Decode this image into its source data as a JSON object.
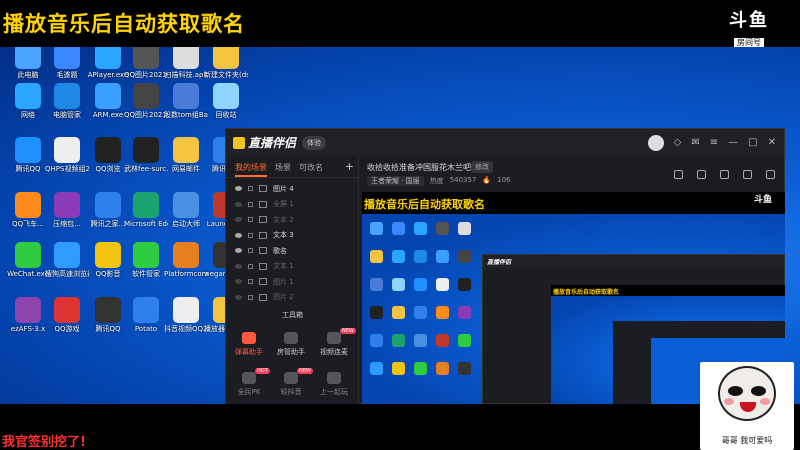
{
  "stream": {
    "title": "播放音乐后自动获取歌名",
    "logo_mark": "斗鱼",
    "logo_sub": "房间号",
    "room_id": "540357",
    "bottom_caption": "我官签别挖了!"
  },
  "desktop": {
    "icons": [
      {
        "label": "此电脑",
        "color": "#4aa3ff"
      },
      {
        "label": "毛遂题",
        "color": "#3a86ff"
      },
      {
        "label": "APlayer.exe",
        "color": "#2ba6ff"
      },
      {
        "label": "QQ图片20210611...",
        "color": "#555"
      },
      {
        "label": "扫描科技.apk",
        "color": "#ddd"
      },
      {
        "label": "新建文件夹(dsdbO).s...",
        "color": "#f5c542"
      },
      {
        "label": "网络",
        "color": "#2ba6ff"
      },
      {
        "label": "电脑管家",
        "color": "#1e88e5"
      },
      {
        "label": "ARM.exe",
        "color": "#3aa0ff"
      },
      {
        "label": "QQ图片20210930...",
        "color": "#444"
      },
      {
        "label": "股数tom组Bakcu...",
        "color": "#4a7bd8"
      },
      {
        "label": "回收站",
        "color": "#8fd3ff"
      },
      {
        "label": "腾讯QQ",
        "color": "#1e90ff"
      },
      {
        "label": "QHPS视频组20...",
        "color": "#eee"
      },
      {
        "label": "QQ浏览",
        "color": "#222"
      },
      {
        "label": "武林fee-surc...",
        "color": "#222"
      },
      {
        "label": "网易邮件",
        "color": "#f5c542"
      },
      {
        "label": "腾讯会议",
        "color": "#2f80ed"
      },
      {
        "label": "QQ飞车...",
        "color": "#ff8c1a"
      },
      {
        "label": "压缩包...",
        "color": "#8b3ab8"
      },
      {
        "label": "腾讯之家...",
        "color": "#2f80ed"
      },
      {
        "label": "Microsoft Edge",
        "color": "#1aa36f"
      },
      {
        "label": "启动大师",
        "color": "#4a90e2"
      },
      {
        "label": "Launcher...",
        "color": "#c0392b"
      },
      {
        "label": "WeChat.exe",
        "color": "#2ecc40"
      },
      {
        "label": "搜狗高速浏览器",
        "color": "#2f9bff"
      },
      {
        "label": "QQ影音",
        "color": "#f1c40f"
      },
      {
        "label": "软件管家",
        "color": "#2ecc40"
      },
      {
        "label": "Platformcore.exe",
        "color": "#e67e22"
      },
      {
        "label": "wegame.exe",
        "color": "#333"
      },
      {
        "label": "ezAFS-3.x",
        "color": "#8e44ad"
      },
      {
        "label": "QQ游戏",
        "color": "#d33"
      },
      {
        "label": "腾讯QQ",
        "color": "#333"
      },
      {
        "label": "Potato",
        "color": "#2f80ed"
      },
      {
        "label": "抖音视频QQ20210...",
        "color": "#eee"
      },
      {
        "label": "播放器和应用...",
        "color": "#f5c542"
      }
    ]
  },
  "app": {
    "name": "直播伴侣",
    "badge": "体验",
    "scene_tabs": [
      "我的场景",
      "场景",
      "可改名"
    ],
    "layers": [
      {
        "name": "图片 4",
        "on": true
      },
      {
        "name": "全屏 1",
        "on": false
      },
      {
        "name": "文本 2",
        "on": false
      },
      {
        "name": "文本 3",
        "on": true
      },
      {
        "name": "歌名",
        "on": true
      },
      {
        "name": "文本 1",
        "on": false
      },
      {
        "name": "图片 1",
        "on": false
      },
      {
        "name": "图片 2",
        "on": false
      }
    ],
    "toolbox_title": "工具箱",
    "tools": [
      {
        "label": "弹幕助手",
        "tag": ""
      },
      {
        "label": "房管助手",
        "tag": ""
      },
      {
        "label": "视频连麦",
        "tag": "NEW"
      },
      {
        "label": "全民PK",
        "tag": "HOT"
      },
      {
        "label": "轻抖音",
        "tag": "NEW"
      },
      {
        "label": "上一起玩",
        "tag": ""
      }
    ],
    "room_title": "收拾收拾准备冲国服花木兰吧",
    "edit_label": "修改",
    "room_category": "王者荣耀 · 国服",
    "room_views_label": "热度",
    "room_views": "540357",
    "room_fans": "106"
  }
}
